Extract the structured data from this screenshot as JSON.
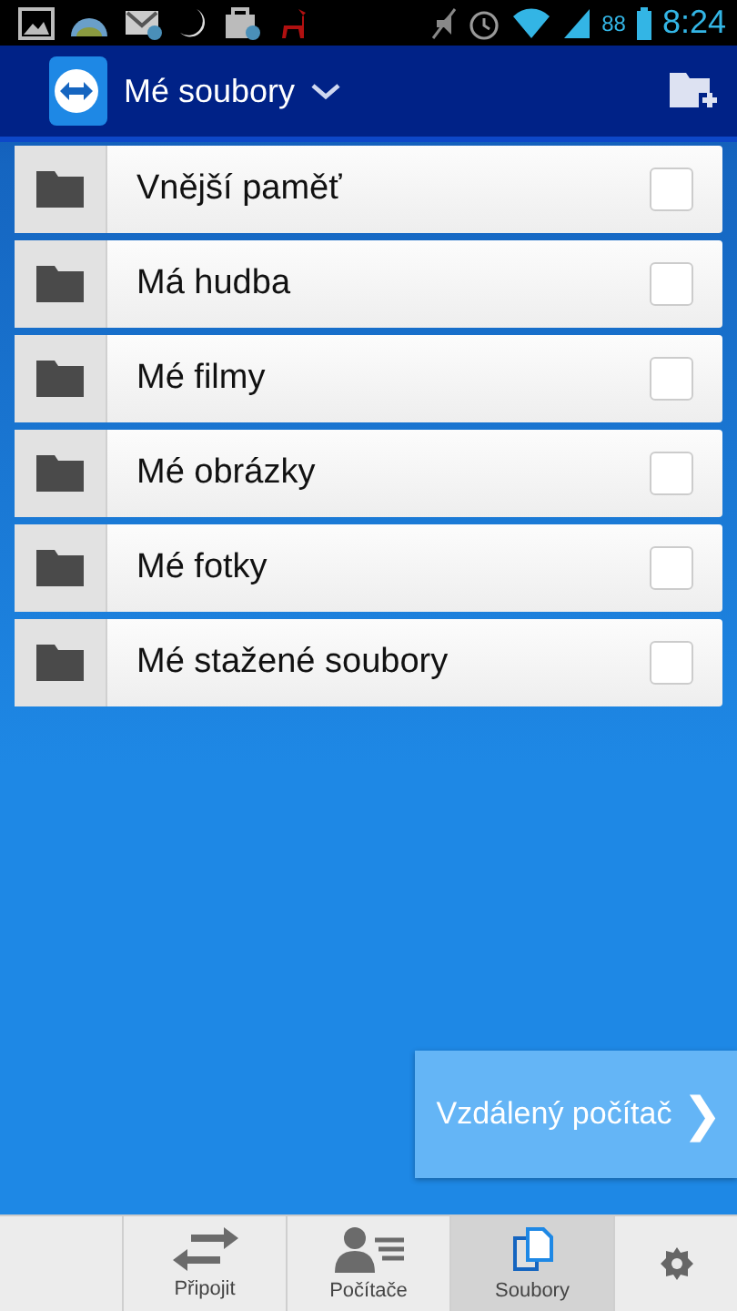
{
  "status_bar": {
    "battery": "88",
    "time": "8:24"
  },
  "header": {
    "title": "Mé soubory"
  },
  "folders": [
    {
      "name": "Vnější paměť",
      "checked": false
    },
    {
      "name": "Má hudba",
      "checked": false
    },
    {
      "name": "Mé filmy",
      "checked": false
    },
    {
      "name": "Mé obrázky",
      "checked": false
    },
    {
      "name": "Mé fotky",
      "checked": false
    },
    {
      "name": "Mé stažené soubory",
      "checked": false
    }
  ],
  "remote_button": {
    "label": "Vzdálený počítač",
    "arrow": "❯"
  },
  "nav": [
    {
      "kind": "blank",
      "selected": false
    },
    {
      "kind": "connect",
      "label": "Připojit",
      "selected": false
    },
    {
      "kind": "computers",
      "label": "Počítače",
      "selected": false
    },
    {
      "kind": "files",
      "label": "Soubory",
      "selected": true
    },
    {
      "kind": "settings",
      "selected": false
    }
  ]
}
